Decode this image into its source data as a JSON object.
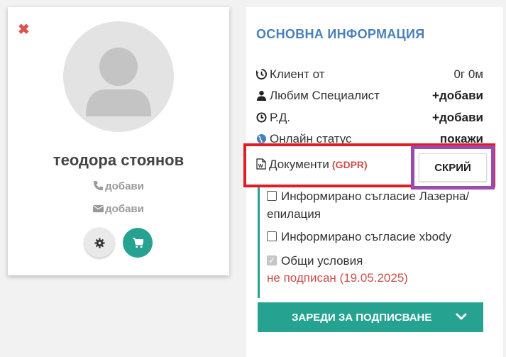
{
  "profile": {
    "close_glyph": "✖",
    "name": "теодора стоянов",
    "phone_label": "добави",
    "email_label": "добави"
  },
  "info": {
    "heading": "ОСНОВНА ИНФОРМАЦИЯ",
    "rows": [
      {
        "icon": "history-icon",
        "label": "Клиент от",
        "value": "0г 0м"
      },
      {
        "icon": "user-icon",
        "label": "Любим Специалист",
        "value": "+добави"
      },
      {
        "icon": "clock-icon",
        "label": "Р.Д.",
        "value": "+добави"
      },
      {
        "icon": "globe-icon",
        "label": "Онлайн статус",
        "value": "покажи"
      }
    ],
    "documents": {
      "label": "Документи",
      "tag": "(GDPR)",
      "hide_button": "СКРИЙ",
      "items": [
        {
          "label": "Информирано съгласие Лазерна/епилация",
          "checked": false
        },
        {
          "label": "Информирано съгласие xbody",
          "checked": false
        },
        {
          "label": "Общи условия",
          "checked": true
        }
      ],
      "status": "не подписан (19.05.2025)"
    },
    "sign_button": "ЗАРЕДИ ЗА ПОДПИСВАНЕ"
  },
  "colors": {
    "teal": "#25a390",
    "heading_blue": "#4a7fb8",
    "highlight_red": "#e31b23",
    "highlight_purple": "#9a4ab0",
    "warning_red": "#c9504c"
  }
}
